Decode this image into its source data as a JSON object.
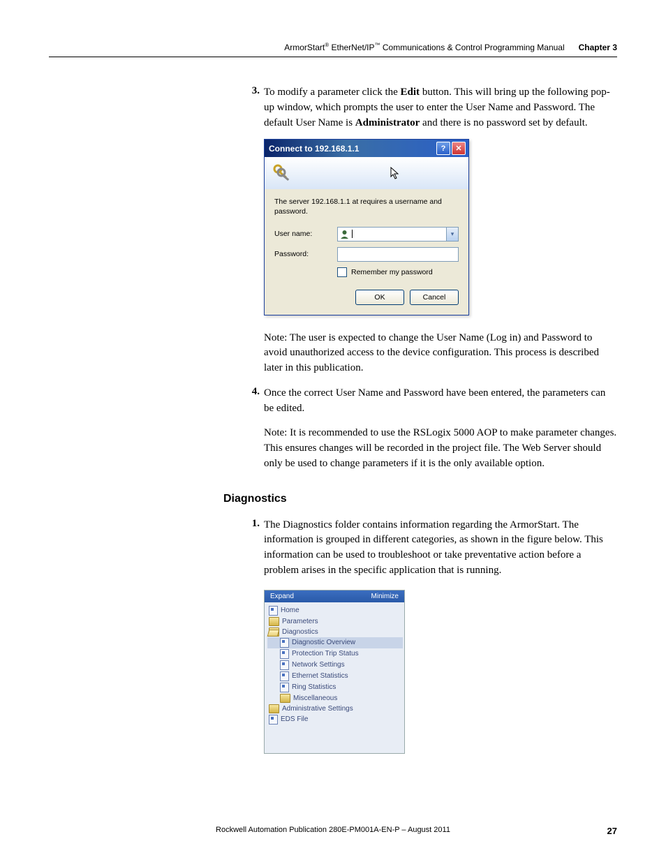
{
  "header": {
    "title_pre": "ArmorStart",
    "title_mid": " EtherNet/IP",
    "title_post": " Communications & Control Programming Manual",
    "chapter": "Chapter 3"
  },
  "step3": {
    "num": "3.",
    "text_1": "To modify a parameter click the ",
    "bold_1": "Edit",
    "text_2": " button. This will bring up the following pop-up window, which prompts the user to enter the User Name and Password. The default User Name is ",
    "bold_2": "Administrator",
    "text_3": " and there is no password set by default."
  },
  "dialog": {
    "title": "Connect to 192.168.1.1",
    "help_glyph": "?",
    "close_glyph": "✕",
    "message": "The server 192.168.1.1 at  requires a username and password.",
    "username_label": "User name:",
    "password_label": "Password:",
    "caret": "▾",
    "remember": "Remember my password",
    "ok": "OK",
    "cancel": "Cancel"
  },
  "note1": {
    "label": "Note:",
    "text": " The user is expected to change the User Name (Log in) and Password to avoid unauthorized access to the device configuration. This process is described later in this publication."
  },
  "step4": {
    "num": "4.",
    "text": "Once the correct User Name and Password have been entered, the parameters can be edited."
  },
  "note2": {
    "label": "Note:",
    "text": " It is recommended to use the RSLogix 5000 AOP to make parameter changes. This ensures changes will be recorded in the project file. The Web Server should only be used to change parameters if it is the only available option."
  },
  "section_heading": "Diagnostics",
  "step1b": {
    "num": "1.",
    "text": "The Diagnostics folder contains information regarding the ArmorStart. The information is grouped in different categories, as shown in the figure below. This information can be used to troubleshoot or take preventative action before a problem arises in the specific application that is running."
  },
  "navtree": {
    "expand": "Expand",
    "minimize": "Minimize",
    "items": {
      "home": "Home",
      "parameters": "Parameters",
      "diagnostics": "Diagnostics",
      "diag_overview": "Diagnostic Overview",
      "protection": "Protection Trip Status",
      "network": "Network Settings",
      "ethernet": "Ethernet Statistics",
      "ring": "Ring Statistics",
      "misc": "Miscellaneous",
      "admin": "Administrative Settings",
      "eds": "EDS File"
    }
  },
  "footer": {
    "pub": "Rockwell Automation Publication 280E-PM001A-EN-P – August 2011",
    "page": "27"
  }
}
